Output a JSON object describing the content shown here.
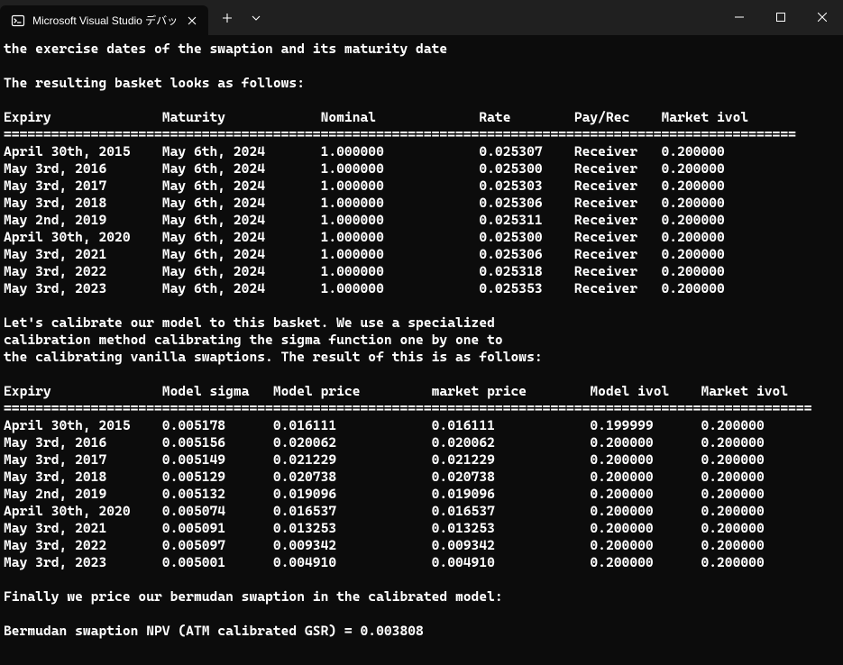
{
  "tab": {
    "title": "Microsoft Visual Studio デバッ"
  },
  "body": {
    "line1": "the exercise dates of the swaption and its maturity date",
    "blank1": "",
    "line2": "The resulting basket looks as follows:",
    "blank2": "",
    "t1_header": "Expiry              Maturity            Nominal             Rate        Pay/Rec    Market ivol",
    "t1_sep": "====================================================================================================",
    "t1_rows": [
      "April 30th, 2015    May 6th, 2024       1.000000            0.025307    Receiver   0.200000",
      "May 3rd, 2016       May 6th, 2024       1.000000            0.025300    Receiver   0.200000",
      "May 3rd, 2017       May 6th, 2024       1.000000            0.025303    Receiver   0.200000",
      "May 3rd, 2018       May 6th, 2024       1.000000            0.025306    Receiver   0.200000",
      "May 2nd, 2019       May 6th, 2024       1.000000            0.025311    Receiver   0.200000",
      "April 30th, 2020    May 6th, 2024       1.000000            0.025300    Receiver   0.200000",
      "May 3rd, 2021       May 6th, 2024       1.000000            0.025306    Receiver   0.200000",
      "May 3rd, 2022       May 6th, 2024       1.000000            0.025318    Receiver   0.200000",
      "May 3rd, 2023       May 6th, 2024       1.000000            0.025353    Receiver   0.200000"
    ],
    "blank3": "",
    "p2_l1": "Let's calibrate our model to this basket. We use a specialized",
    "p2_l2": "calibration method calibrating the sigma function one by one to",
    "p2_l3": "the calibrating vanilla swaptions. The result of this is as follows:",
    "blank4": "",
    "t2_header": "Expiry              Model sigma   Model price         market price        Model ivol    Market ivol",
    "t2_sep": "======================================================================================================",
    "t2_rows": [
      "April 30th, 2015    0.005178      0.016111            0.016111            0.199999      0.200000",
      "May 3rd, 2016       0.005156      0.020062            0.020062            0.200000      0.200000",
      "May 3rd, 2017       0.005149      0.021229            0.021229            0.200000      0.200000",
      "May 3rd, 2018       0.005129      0.020738            0.020738            0.200000      0.200000",
      "May 2nd, 2019       0.005132      0.019096            0.019096            0.200000      0.200000",
      "April 30th, 2020    0.005074      0.016537            0.016537            0.200000      0.200000",
      "May 3rd, 2021       0.005091      0.013253            0.013253            0.200000      0.200000",
      "May 3rd, 2022       0.005097      0.009342            0.009342            0.200000      0.200000",
      "May 3rd, 2023       0.005001      0.004910            0.004910            0.200000      0.200000"
    ],
    "blank5": "",
    "p3": "Finally we price our bermudan swaption in the calibrated model:",
    "blank6": "",
    "p4": "Bermudan swaption NPV (ATM calibrated GSR) = 0.003808"
  }
}
